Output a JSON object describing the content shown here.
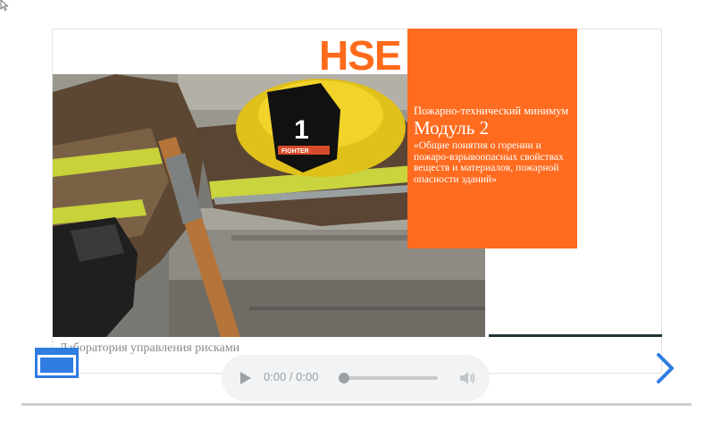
{
  "slide": {
    "logo_text": "HSE",
    "card": {
      "subtitle": "Пожарно-технический минимум",
      "title": "Модуль 2",
      "description": "«Общие понятия о горении и пожаро-взрывоопасных свойствах веществ и материалов, пожарной опасности зданий»"
    },
    "footer_text": "Лаборатория управления рисками",
    "photo_number": "1",
    "helmet_badge_text": "FIGHTER"
  },
  "audio_player": {
    "time_display": "0:00 / 0:00",
    "progress": 0
  },
  "colors": {
    "accent_orange": "#ff6b1f",
    "nav_blue": "#2f7de1",
    "dark_strip": "#1f3437"
  },
  "icons": {
    "screen": "screen-toggle-icon",
    "next": "chevron-right-icon",
    "play": "play-icon",
    "volume": "volume-icon",
    "cursor": "cursor-arrow-icon"
  }
}
